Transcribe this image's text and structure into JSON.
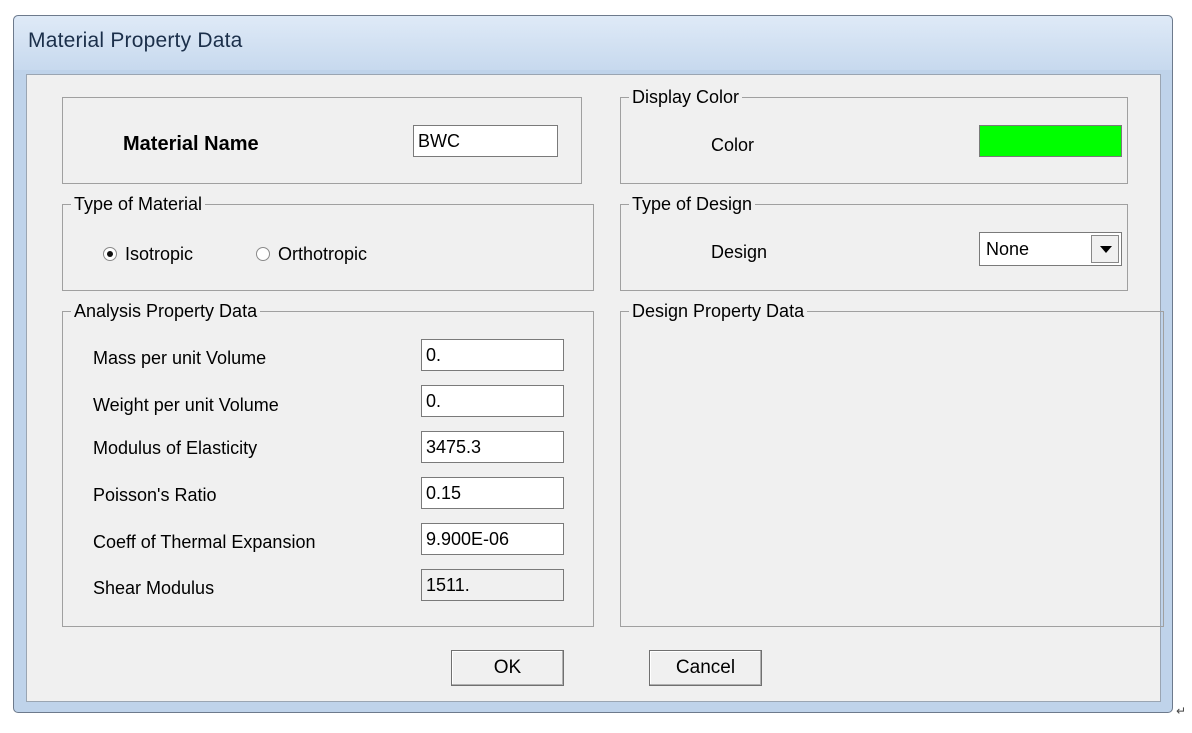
{
  "window": {
    "title": "Material Property Data"
  },
  "material_name": {
    "label": "Material Name",
    "value": "BWC"
  },
  "display_color": {
    "legend": "Display Color",
    "color_label": "Color",
    "color_hex": "#00ff00"
  },
  "type_of_material": {
    "legend": "Type of Material",
    "options": [
      {
        "label": "Isotropic",
        "selected": true
      },
      {
        "label": "Orthotropic",
        "selected": false
      }
    ]
  },
  "type_of_design": {
    "legend": "Type of Design",
    "design_label": "Design",
    "design_value": "None"
  },
  "analysis_property_data": {
    "legend": "Analysis Property Data",
    "rows": [
      {
        "label": "Mass per unit Volume",
        "value": "0."
      },
      {
        "label": "Weight per unit Volume",
        "value": "0."
      },
      {
        "label": "Modulus of Elasticity",
        "value": "3475.3"
      },
      {
        "label": "Poisson's Ratio",
        "value": "0.15"
      },
      {
        "label": "Coeff of Thermal Expansion",
        "value": "9.900E-06"
      },
      {
        "label": "Shear Modulus",
        "value": "1511."
      }
    ]
  },
  "design_property_data": {
    "legend": "Design Property Data"
  },
  "buttons": {
    "ok": "OK",
    "cancel": "Cancel"
  },
  "colors": {
    "window_frame": "#bfd3ea",
    "client_bg": "#f0f0f0"
  }
}
